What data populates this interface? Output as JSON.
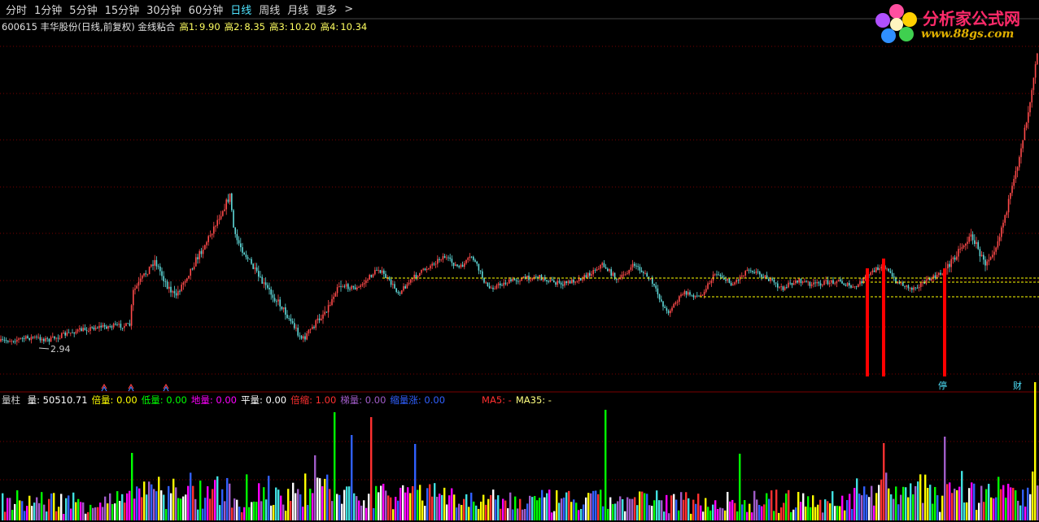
{
  "toolbar": {
    "periods": [
      "分时",
      "1分钟",
      "5分钟",
      "15分钟",
      "30分钟",
      "60分钟",
      "日线",
      "周线",
      "月线",
      "更多"
    ],
    "active": "日线",
    "more_arrow": ">"
  },
  "stock": {
    "title": "600615 丰华股份(日线,前复权) 金线粘合",
    "h1_label": "高1:",
    "h1": "9.90",
    "h2_label": "高2:",
    "h2": "8.35",
    "h3_label": "高3:",
    "h3": "10.20",
    "h4_label": "高4:",
    "h4": "10.34"
  },
  "logo": {
    "name": "分析家公式网",
    "url": "www.88gs.com"
  },
  "price_chart": {
    "low_marker": "2.94",
    "signal_tags": [
      {
        "text": "停",
        "color": "#4fe4ff"
      },
      {
        "text": "财",
        "color": "#4fe4ff"
      }
    ]
  },
  "volume": {
    "title": "量柱",
    "items": [
      {
        "label": "量:",
        "value": "50510.71",
        "color": "#ffffff"
      },
      {
        "label": "倍量:",
        "value": "0.00",
        "color": "#ffff00"
      },
      {
        "label": "低量:",
        "value": "0.00",
        "color": "#00ff00"
      },
      {
        "label": "地量:",
        "value": "0.00",
        "color": "#ff00ff"
      },
      {
        "label": "平量:",
        "value": "0.00",
        "color": "#ffffff"
      },
      {
        "label": "倍缩:",
        "value": "1.00",
        "color": "#ff3030"
      },
      {
        "label": "梯量:",
        "value": "0.00",
        "color": "#a05cc8"
      },
      {
        "label": "缩量涨:",
        "value": "0.00",
        "color": "#3060ff"
      },
      {
        "label": "MA5:",
        "value": "-",
        "color": "#ff3030"
      },
      {
        "label": "MA35:",
        "value": "-",
        "color": "#ffff80"
      }
    ]
  },
  "colors": {
    "up": "#ff4a4a",
    "down": "#5fd9d9",
    "grid": "#7a0000",
    "golden_line": "#ffff00",
    "signal_bar": "#ff0000"
  }
}
